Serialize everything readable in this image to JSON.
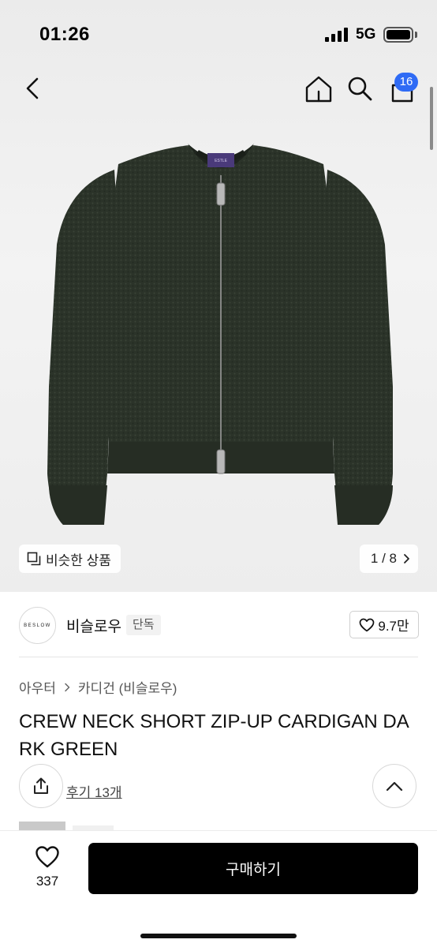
{
  "status_bar": {
    "time": "01:26",
    "network": "5G"
  },
  "header": {
    "cart_count": "16"
  },
  "gallery": {
    "similar_label": "비슷한 상품",
    "page_indicator": "1 / 8",
    "neck_label": "ESTLE"
  },
  "brand": {
    "logo_text": "BESLOW",
    "name": "비슬로우",
    "badge": "단독",
    "likes": "9.7만"
  },
  "breadcrumb": {
    "category": "아우터",
    "subcategory": "카디건 (비슬로우)"
  },
  "product": {
    "title": "CREW NECK SHORT ZIP-UP CARDIGAN DARK GREEN",
    "reviews": "후기 13개"
  },
  "bottom_bar": {
    "wish_count": "337",
    "buy_label": "구매하기"
  },
  "colors": {
    "accent": "#2f6bf5",
    "garment": "#2a3229",
    "buy_button": "#000000"
  }
}
